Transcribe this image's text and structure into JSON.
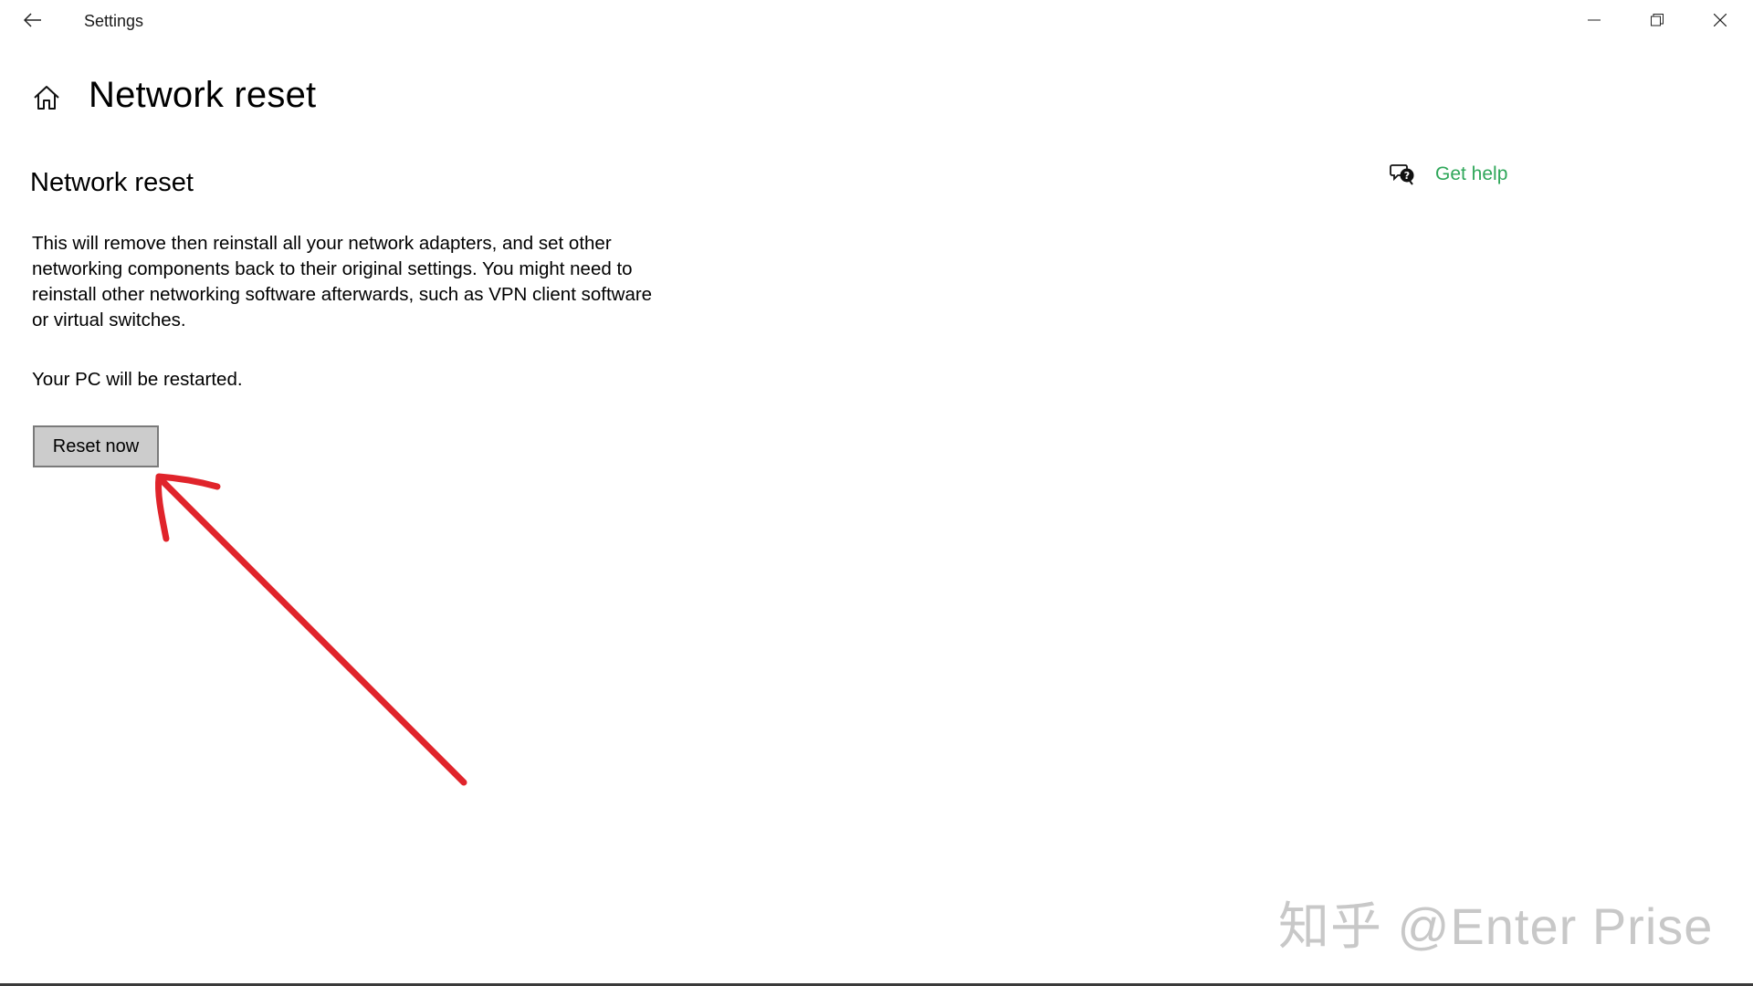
{
  "window": {
    "title": "Settings",
    "controls": [
      "minimize",
      "restore",
      "close"
    ]
  },
  "icons": {
    "back": "back-arrow-icon",
    "home": "home-icon",
    "help": "chat-question-icon",
    "minimize": "minimize-icon",
    "restore": "restore-icon",
    "close": "close-icon"
  },
  "page": {
    "title": "Network reset",
    "section_heading": "Network reset",
    "description": "This will remove then reinstall all your network adapters, and set other networking components back to their original settings. You might need to reinstall other networking software afterwards, such as VPN client software or virtual switches.",
    "restart_note": "Your PC will be restarted.",
    "reset_button": "Reset now"
  },
  "help": {
    "label": "Get help"
  },
  "annotation": {
    "arrow_color": "#e0242b"
  },
  "watermark": {
    "text": "知乎 @Enter Prise"
  },
  "colors": {
    "link": "#2fa75a",
    "button_bg": "#cccccc",
    "button_border": "#7a7a7a"
  }
}
